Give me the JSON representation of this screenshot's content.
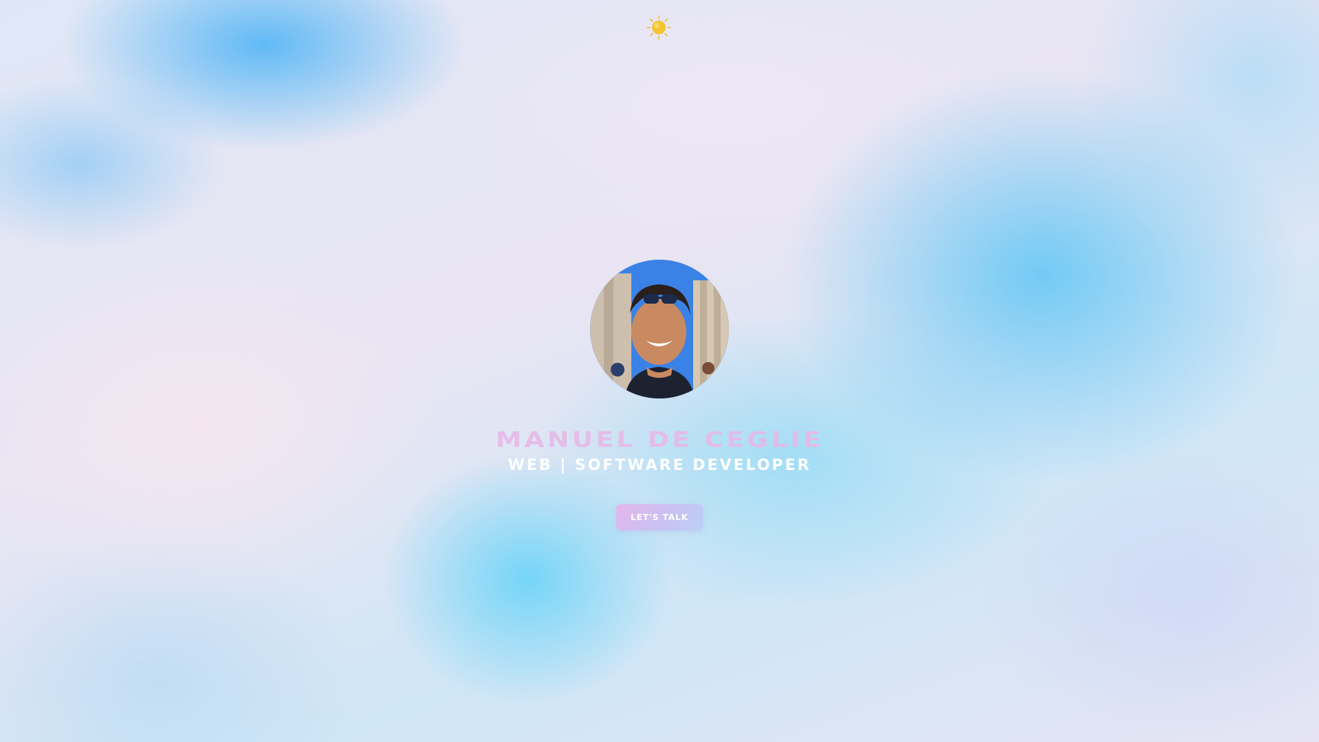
{
  "header": {
    "theme_toggle_icon": "sun-icon"
  },
  "hero": {
    "name": "MANUEL DE CEGLIE",
    "role": "WEB | SOFTWARE DEVELOPER",
    "cta_label": "LET'S TALK",
    "avatar_alt": "Portrait photo"
  },
  "colors": {
    "name_text": "#e7b9e8",
    "role_text": "#ffffff",
    "cta_gradient_start": "#e4b6ec",
    "cta_gradient_end": "#bcd0f6",
    "sun": "#f4c430"
  }
}
